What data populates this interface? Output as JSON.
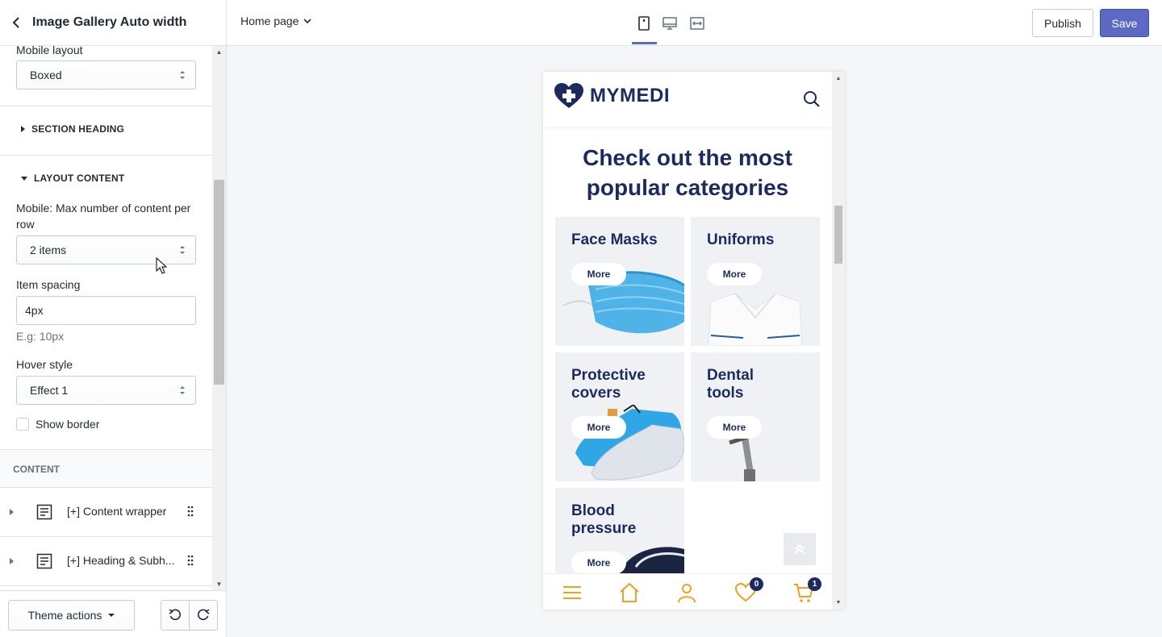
{
  "sidebar": {
    "title": "Image Gallery Auto width",
    "mobile_layout": {
      "label": "Mobile layout",
      "value": "Boxed"
    },
    "section_heading": "SECTION HEADING",
    "layout_content": "LAYOUT CONTENT",
    "max_content": {
      "label": "Mobile: Max number of content per row",
      "value": "2 items"
    },
    "item_spacing": {
      "label": "Item spacing",
      "value": "4px",
      "hint": "E.g: 10px"
    },
    "hover_style": {
      "label": "Hover style",
      "value": "Effect 1"
    },
    "show_border": {
      "label": "Show border",
      "checked": false
    },
    "content_label": "CONTENT",
    "blocks": [
      {
        "label": "[+] Content wrapper",
        "icon": "document-icon"
      },
      {
        "label": "[+] Heading & Subh...",
        "icon": "document-icon"
      }
    ],
    "theme_actions": "Theme actions"
  },
  "topbar": {
    "page": "Home page",
    "devices": [
      "mobile-icon",
      "desktop-icon",
      "fullwidth-icon"
    ],
    "publish": "Publish",
    "save": "Save",
    "accent": "#5c6ac4"
  },
  "preview": {
    "brand": "MYMEDI",
    "heading": "Check out the most popular categories",
    "brand_color": "#1c2b5f",
    "categories": [
      {
        "title": "Face Masks",
        "button": "More"
      },
      {
        "title": "Uniforms",
        "button": "More"
      },
      {
        "title": "Protective covers",
        "button": "More"
      },
      {
        "title": "Dental tools",
        "button": "More"
      },
      {
        "title": "Blood pressure",
        "button": "More"
      }
    ],
    "nav": {
      "items": [
        "menu-icon",
        "home-icon",
        "account-icon",
        "wishlist-icon",
        "cart-icon"
      ],
      "wishlist_count": "0",
      "cart_count": "1",
      "icon_color": "#f2a01f"
    }
  }
}
